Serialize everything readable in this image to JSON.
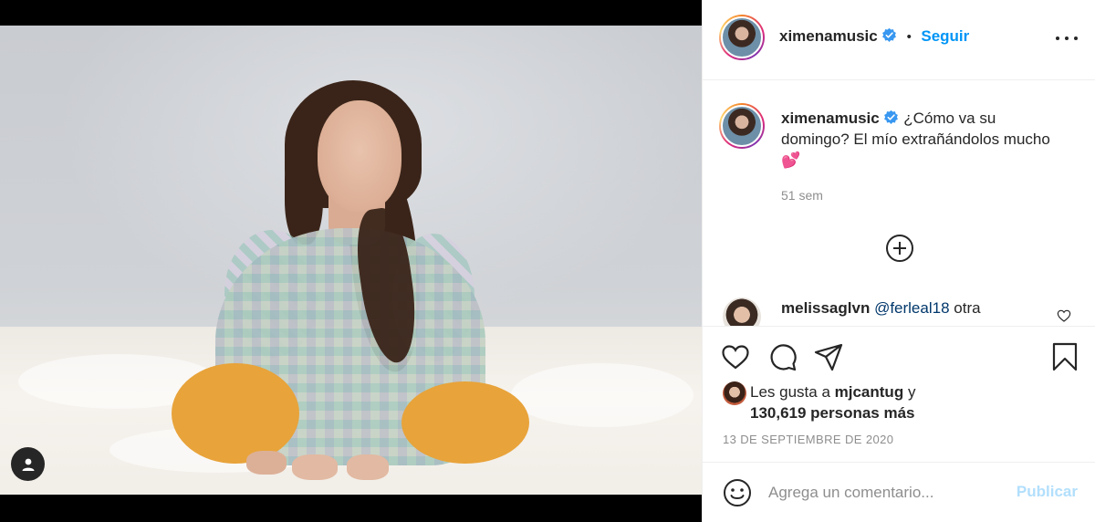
{
  "post": {
    "media": {
      "alt_icon": "user-tag-icon",
      "background": "#000000"
    },
    "header": {
      "username": "ximenamusic",
      "verified": true,
      "separator": "•",
      "follow_label": "Seguir",
      "more_icon": "more-options-icon"
    },
    "caption": {
      "username": "ximenamusic",
      "text": "¿Cómo va su domingo? El mío extrañándolos mucho",
      "emoji": "💕",
      "time": "51 sem"
    },
    "load_more_icon": "plus-circle-icon",
    "comments": [
      {
        "username": "melissaglvn",
        "mention": "@ferleal18",
        "text": "otra"
      }
    ],
    "actions": {
      "like_icon": "heart-icon",
      "comment_icon": "comment-icon",
      "share_icon": "send-icon",
      "save_icon": "bookmark-icon"
    },
    "likes": {
      "prefix": "Les gusta a",
      "first_user": "mjcantug",
      "conjunction": "y",
      "others": "130,619 personas más"
    },
    "date": "13 DE SEPTIEMBRE DE 2020",
    "add_comment": {
      "placeholder": "Agrega un comentario...",
      "post_label": "Publicar"
    },
    "colors": {
      "accent": "#0095f6",
      "post_disabled": "#b2dffc",
      "muted": "#8e8e8e",
      "text": "#262626"
    }
  }
}
